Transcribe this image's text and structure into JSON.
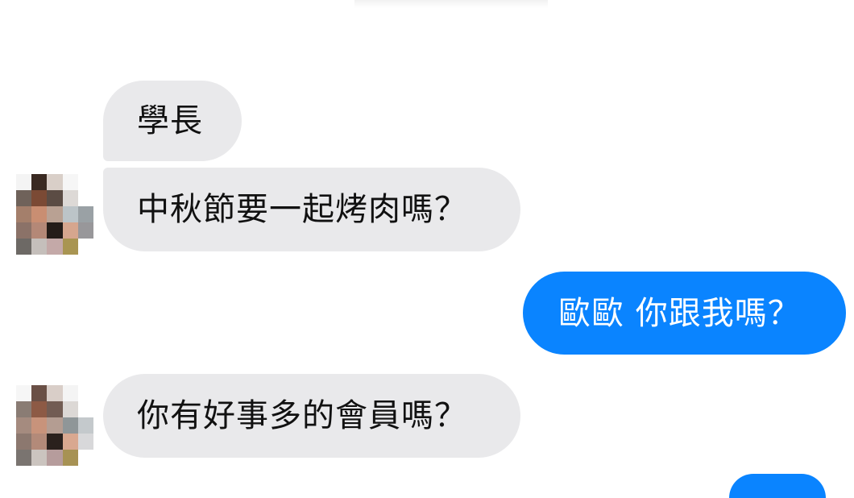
{
  "messages": [
    {
      "sender": "other",
      "text": "學長"
    },
    {
      "sender": "other",
      "text": "中秋節要一起烤肉嗎？"
    },
    {
      "sender": "me",
      "text": "歐歐 你跟我嗎？"
    },
    {
      "sender": "other",
      "text": "你有好事多的會員嗎？"
    }
  ],
  "colors": {
    "incoming_bubble": "#e9e9eb",
    "outgoing_bubble": "#0a84ff",
    "incoming_text": "#111111",
    "outgoing_text": "#ffffff"
  }
}
